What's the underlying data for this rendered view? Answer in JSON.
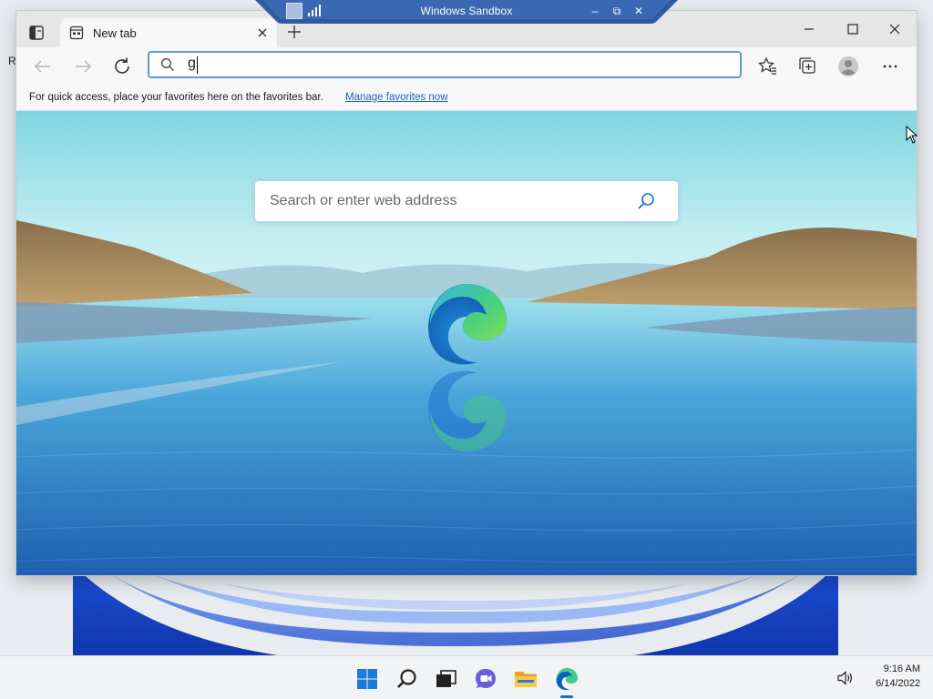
{
  "sandbox": {
    "title": "Windows Sandbox",
    "controls": {
      "minimize": "–",
      "restore": "⧉",
      "close": "✕"
    }
  },
  "browser": {
    "tab": {
      "label": "New tab"
    },
    "address_bar": {
      "value": "g"
    },
    "favorites_bar": {
      "hint": "For quick access, place your favorites here on the favorites bar.",
      "link": "Manage favorites now"
    },
    "new_tab_page": {
      "search_placeholder": "Search or enter web address"
    }
  },
  "desktop": {
    "clipped_label": "R"
  },
  "taskbar": {
    "items": [
      "start-icon",
      "search-icon",
      "task-view-icon",
      "chat-icon",
      "file-explorer-icon",
      "edge-icon"
    ],
    "time": "9:16 AM",
    "date": "6/14/2022"
  },
  "colors": {
    "accent": "#0a74d8",
    "address_border": "#5b9bd5",
    "link": "#1a66c0",
    "sandbox_bar": "#2f5aa0"
  }
}
